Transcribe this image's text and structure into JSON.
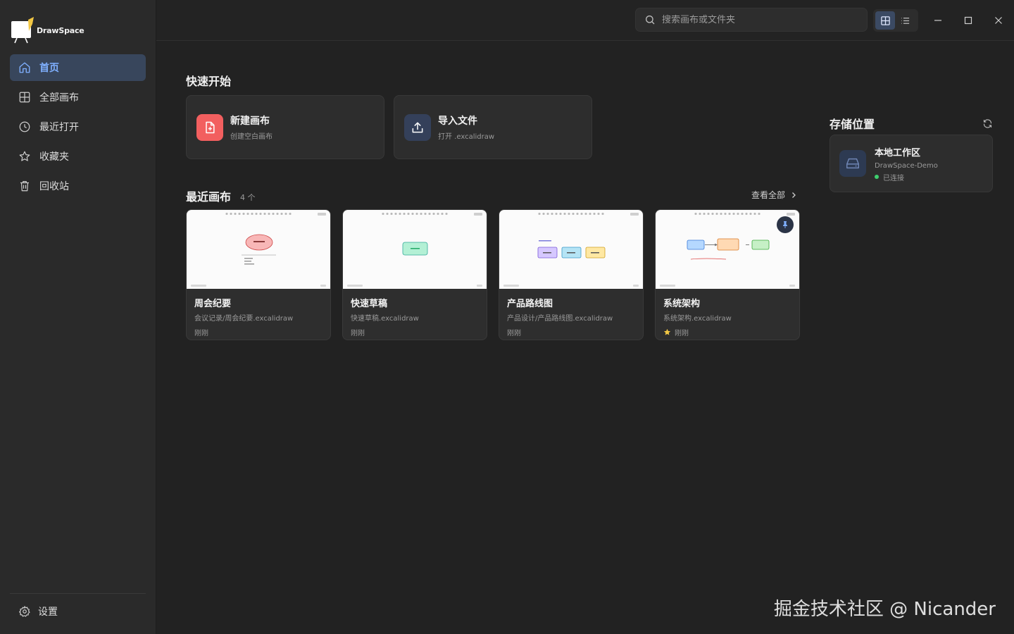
{
  "app": {
    "name": "DrawSpace"
  },
  "sidebar": {
    "items": [
      {
        "label": "首页",
        "icon": "home-icon",
        "active": true
      },
      {
        "label": "全部画布",
        "icon": "grid-icon"
      },
      {
        "label": "最近打开",
        "icon": "clock-icon"
      },
      {
        "label": "收藏夹",
        "icon": "star-icon"
      },
      {
        "label": "回收站",
        "icon": "trash-icon"
      }
    ],
    "settings_label": "设置"
  },
  "topbar": {
    "search_placeholder": "搜索画布或文件夹",
    "view_modes": [
      "grid-icon",
      "list-icon"
    ]
  },
  "quick_start": {
    "title": "快速开始",
    "new": {
      "title": "新建画布",
      "sub": "创建空白画布",
      "color": "#f25f5f"
    },
    "import": {
      "title": "导入文件",
      "sub": "打开 .excalidraw",
      "color": "#34405a"
    }
  },
  "recent": {
    "title": "最近画布",
    "count": "4 个",
    "view_all": "查看全部",
    "cards": [
      {
        "title": "周会纪要",
        "path": "会议记录/周会纪要.excalidraw",
        "time": "刚刚",
        "starred": false,
        "pinned": false
      },
      {
        "title": "快速草稿",
        "path": "快速草稿.excalidraw",
        "time": "刚刚",
        "starred": false,
        "pinned": false
      },
      {
        "title": "产品路线图",
        "path": "产品设计/产品路线图.excalidraw",
        "time": "刚刚",
        "starred": false,
        "pinned": false
      },
      {
        "title": "系统架构",
        "path": "系统架构.excalidraw",
        "time": "刚刚",
        "starred": true,
        "pinned": true
      }
    ]
  },
  "storage": {
    "title": "存储位置",
    "workspace": {
      "title": "本地工作区",
      "name": "DrawSpace-Demo",
      "status": "已连接",
      "status_color": "#3ecf6e"
    }
  },
  "watermark": "掘金技术社区 @ Nicander"
}
